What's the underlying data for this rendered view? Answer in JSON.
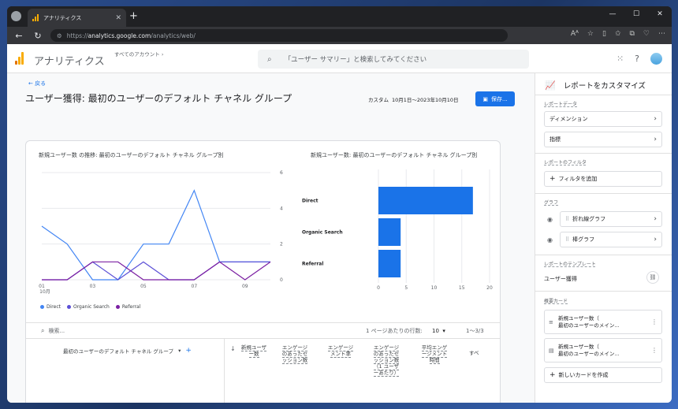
{
  "browser": {
    "tab_title": "アナリティクス",
    "url_scheme": "https://",
    "url_host": "analytics.google.com",
    "url_path": "/analytics/web/"
  },
  "header": {
    "app_title": "アナリティクス",
    "account_label": "すべてのアカウント",
    "search_placeholder": "「ユーザー サマリー」と検索してみてください"
  },
  "main": {
    "back_label": "戻る",
    "page_title": "ユーザー獲得: 最初のユーザーのデフォルト チャネル グループ",
    "date_prefix": "カスタム",
    "date_range": "10月1日～2023年10月10日",
    "save_label": "保存..."
  },
  "chart_data": [
    {
      "type": "line",
      "title": "新規ユーザー数 の推移: 最初のユーザーのデフォルト チャネル グループ別",
      "x": [
        "01",
        "02",
        "03",
        "04",
        "05",
        "06",
        "07",
        "08",
        "09",
        "10"
      ],
      "x_tick_labels": [
        "01",
        "03",
        "05",
        "07",
        "09"
      ],
      "x_sublabel": "10月",
      "yticks": [
        0,
        2,
        4,
        6
      ],
      "ylim": [
        0,
        6
      ],
      "grid": true,
      "series": [
        {
          "name": "Direct",
          "color": "#4285f4",
          "values": [
            3,
            2,
            0,
            0,
            2,
            2,
            5,
            1,
            1,
            1
          ]
        },
        {
          "name": "Organic Search",
          "color": "#5b4fd6",
          "values": [
            0,
            0,
            1,
            0,
            1,
            0,
            0,
            1,
            1,
            1
          ]
        },
        {
          "name": "Referral",
          "color": "#7b1fa2",
          "values": [
            0,
            0,
            1,
            1,
            0,
            0,
            0,
            1,
            0,
            1
          ]
        }
      ]
    },
    {
      "type": "bar",
      "orientation": "horizontal",
      "title": "新規ユーザー数: 最初のユーザーのデフォルト チャネル グループ別",
      "categories": [
        "Direct",
        "Organic Search",
        "Referral"
      ],
      "values": [
        17,
        4,
        4
      ],
      "xticks": [
        0,
        5,
        10,
        15,
        20
      ],
      "xlim": [
        0,
        20
      ],
      "color": "#1a73e8"
    }
  ],
  "table": {
    "search_placeholder": "検索...",
    "rows_per_page_label": "1 ページあたりの行数:",
    "rows_per_page_value": "10",
    "pager": "1～3/3",
    "dimension_header": "最初のユーザーのデフォルト チャネル グループ",
    "metric_headers": [
      "新規ユーザー数",
      "エンゲージのあったセッション数",
      "エンゲージメント率",
      "エンゲージのあったセッション数（1 ユーザーあたり）",
      "平均エンゲージメント時間",
      "すべ"
    ]
  },
  "panel": {
    "title": "レポートをカスタマイズ",
    "report_data_label": "レポートデータ",
    "dimension_label": "ディメンション",
    "metric_label": "指標",
    "filter_section_label": "レポートのフィルタ",
    "add_filter_label": "フィルタを追加",
    "graph_section_label": "グラフ",
    "line_graph_label": "折れ線グラフ",
    "bar_graph_label": "棒グラフ",
    "template_section_label": "レポートのテンプレート",
    "template_name": "ユーザー獲得",
    "summary_section_label": "概要カード",
    "summary_cards": [
      {
        "line1": "新規ユーザー数（",
        "line2": "最初のユーザーのメイン..."
      },
      {
        "line1": "新規ユーザー数（",
        "line2": "最初のユーザーのメイン..."
      }
    ],
    "new_card_label": "新しいカードを作成"
  }
}
